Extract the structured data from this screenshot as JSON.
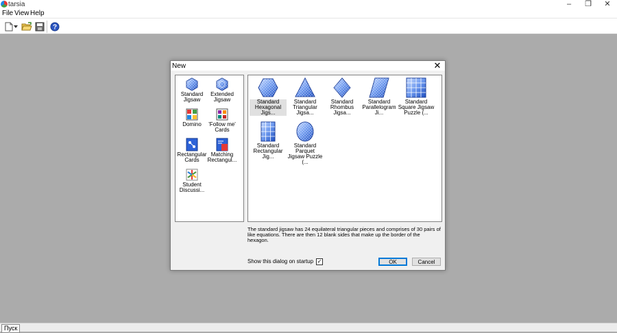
{
  "app": {
    "title": "tarsia"
  },
  "menu": [
    "File",
    "View",
    "Help"
  ],
  "toolbar": {
    "buttons": [
      "new-document-icon",
      "dropdown-arrow-icon",
      "open-folder-icon",
      "save-icon",
      "help-icon"
    ]
  },
  "window_controls": {
    "minimize": "–",
    "maximize": "❐",
    "close": "✕"
  },
  "dialog": {
    "title": "New",
    "close": "✕",
    "categories": [
      {
        "label": "Standard Jigsaw",
        "icon": "hexagon-jigsaw-icon"
      },
      {
        "label": "Extended Jigsaw",
        "icon": "extended-jigsaw-icon"
      },
      {
        "label": "Domino",
        "icon": "domino-icon"
      },
      {
        "label": "'Follow me' Cards",
        "icon": "follow-me-cards-icon"
      },
      {
        "label": "Rectangular Cards",
        "icon": "rectangular-cards-icon"
      },
      {
        "label": "Matching Rectangul...",
        "icon": "matching-rectangular-icon"
      },
      {
        "label": "Student Discussi...",
        "icon": "student-discussion-icon"
      }
    ],
    "templates": [
      {
        "label": "Standard Hexagonal Jigs...",
        "icon": "hexagonal-jigsaw-icon",
        "selected": true
      },
      {
        "label": "Standard Triangular Jigsa...",
        "icon": "triangular-jigsaw-icon"
      },
      {
        "label": "Standard Rhombus Jigsa...",
        "icon": "rhombus-jigsaw-icon"
      },
      {
        "label": "Standard Parallelogram Ji...",
        "icon": "parallelogram-jigsaw-icon"
      },
      {
        "label": "Standard Square Jigsaw Puzzle (...",
        "icon": "square-jigsaw-icon"
      },
      {
        "label": "Standard Rectangular Jig...",
        "icon": "rectangular-jigsaw-icon"
      },
      {
        "label": "Standard Parquet Jigsaw Puzzle (...",
        "icon": "parquet-jigsaw-icon"
      }
    ],
    "description": "The standard jigsaw has 24 equilateral triangular pieces and comprises of 30 pairs of like equations. There are then 12 blank sides that make up the border of the hexagon.",
    "show_on_startup_label": "Show this dialog on startup",
    "show_on_startup_checked": true,
    "ok_label": "OK",
    "cancel_label": "Cancel"
  },
  "taskbar": {
    "start_label": "Пуск"
  },
  "colors": {
    "accent": "#0078d7",
    "icon_blue": "#3f6fd6",
    "workspace": "#ababab"
  }
}
